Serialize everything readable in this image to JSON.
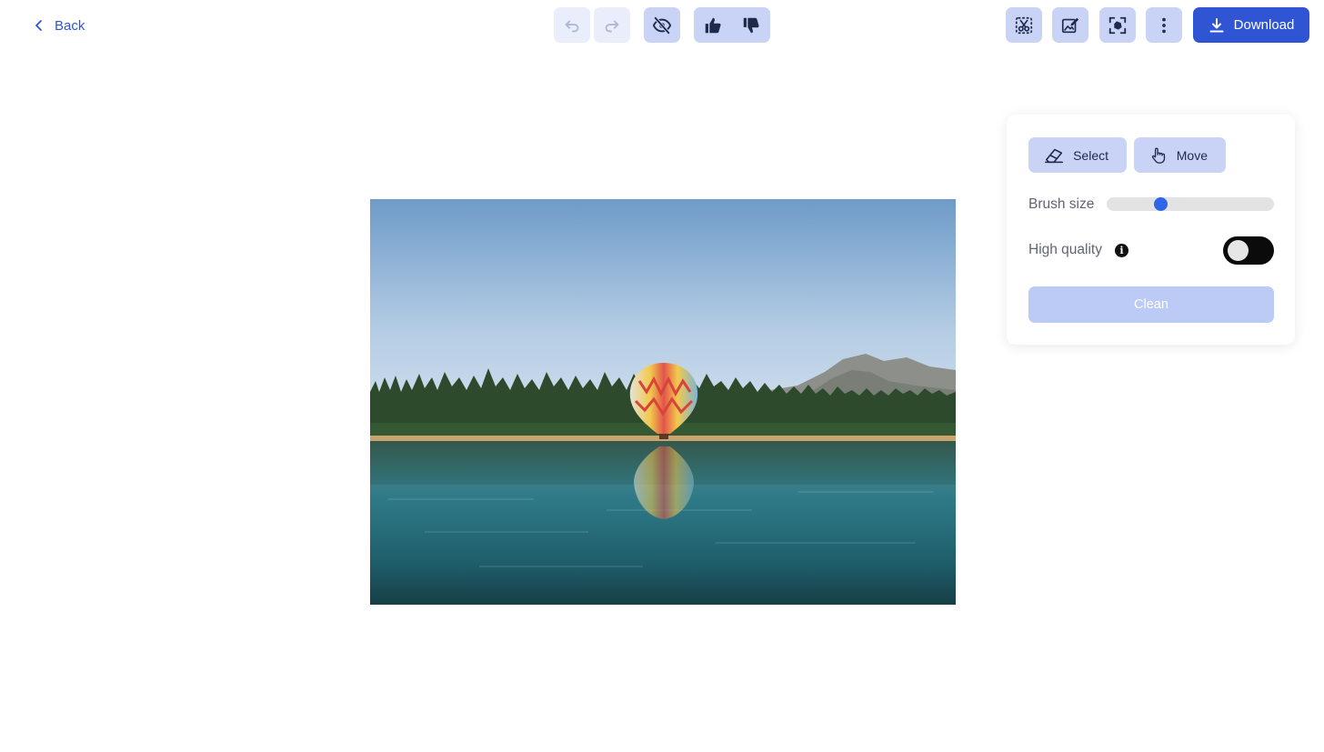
{
  "header": {
    "back_label": "Back",
    "download_label": "Download",
    "buttons": [
      {
        "name": "undo",
        "icon": "undo-icon",
        "disabled": true
      },
      {
        "name": "redo",
        "icon": "redo-icon",
        "disabled": true
      },
      {
        "name": "hide-mask",
        "icon": "eye-off-icon",
        "disabled": false
      },
      {
        "name": "thumbs-up",
        "icon": "thumbs-up-icon",
        "disabled": false
      },
      {
        "name": "thumbs-down",
        "icon": "thumbs-down-icon",
        "disabled": false
      },
      {
        "name": "cutout",
        "icon": "scissors-icon",
        "disabled": false
      },
      {
        "name": "edit-image",
        "icon": "image-edit-icon",
        "disabled": false
      },
      {
        "name": "focus-select",
        "icon": "focus-icon",
        "disabled": false
      },
      {
        "name": "more",
        "icon": "more-vertical-icon",
        "disabled": false
      }
    ]
  },
  "image": {
    "description_icon": "photo-hot-air-balloon-lake"
  },
  "panel": {
    "select_label": "Select",
    "move_label": "Move",
    "brush_size_label": "Brush size",
    "brush_size_fraction": 0.31,
    "high_quality_label": "High quality",
    "high_quality_enabled": false,
    "info_glyph": "i",
    "clean_label": "Clean",
    "clean_disabled": true
  },
  "colors": {
    "accent": "#2f55d4",
    "button_bg": "#c9d3f5",
    "button_disabled_bg": "#eaeefb",
    "clean_disabled_bg": "#bccaf6",
    "slider_thumb": "#2f66e8",
    "toggle_bg": "#0b0b0b"
  }
}
